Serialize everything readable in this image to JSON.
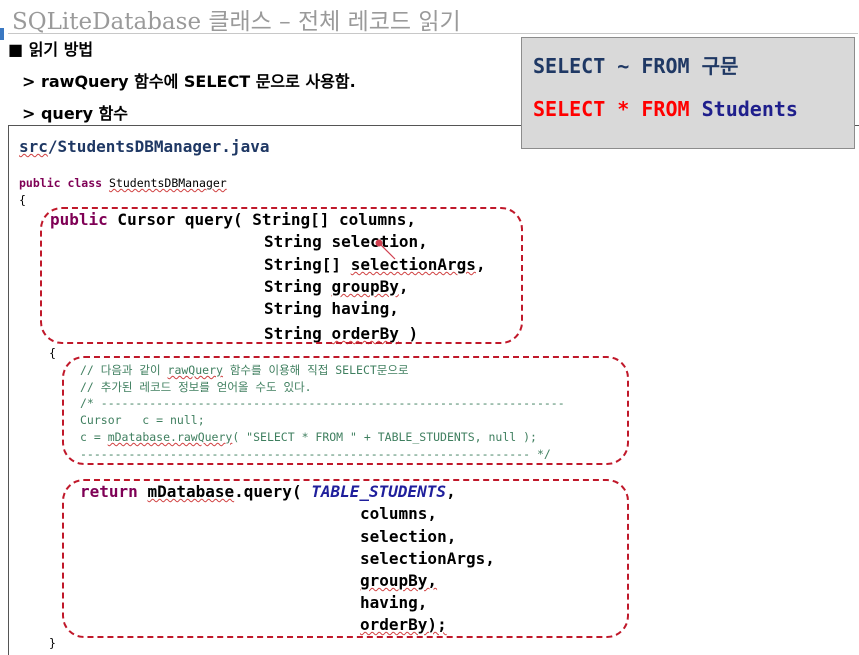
{
  "slide": {
    "title": "SQLiteDatabase 클래스 – 전체 레코드 읽기",
    "bullet": "■ 읽기 방법",
    "sub1": "> rawQuery 함수에 SELECT 문으로 사용함.",
    "sub2": "> query 함수"
  },
  "sql_box": {
    "line1": "SELECT ~ FROM 구문",
    "line2_select": "SELECT",
    "line2_star": "*",
    "line2_from": "FROM",
    "line2_table": "Students"
  },
  "code": {
    "filepath_src": "src",
    "filepath_rest": "/StudentsDBManager.java",
    "class_kw": "public class ",
    "class_name": "StudentsDBManager",
    "brace_open": "{",
    "sig": {
      "line1_kw": "public",
      "line1_rest": " Cursor query( String[] columns,",
      "line2_type": "String ",
      "line2_param": "selection",
      "line2_end": ",",
      "line3_type": "String[] ",
      "line3_param": "selectionArgs",
      "line3_end": ",",
      "line4_type": "String ",
      "line4_param": "groupBy",
      "line4_end": ",",
      "line5": "String having,",
      "line6_type": "String ",
      "line6_param": "orderBy",
      "line6_end": " )"
    },
    "inner_brace": "{",
    "comment": {
      "line1_a": "// 다음과 같이 ",
      "line1_b": "rawQuery",
      "line1_c": " 함수를 이용해 직접 SELECT문으로",
      "line2": "// 추가된 레코드 정보를 얻어올 수도 있다.",
      "line3": "/* -------------------------------------------------------------------",
      "line4": "Cursor   c = null;",
      "line5_a": "c = ",
      "line5_b": "mDatabase.rawQuery",
      "line5_c": "( \"SELECT * FROM \" + TABLE_STUDENTS, null );",
      "line6": "----------------------------------------------------------------- */"
    },
    "ret": {
      "kw": "return",
      "obj": "mDatabase",
      "method": ".query",
      "paren": "( ",
      "table": "TABLE_STUDENTS",
      "comma": ",",
      "args": [
        "columns,",
        "selection,",
        "selectionArgs,",
        "groupBy,",
        "having,",
        "orderBy);"
      ]
    },
    "close_brace": "}"
  }
}
